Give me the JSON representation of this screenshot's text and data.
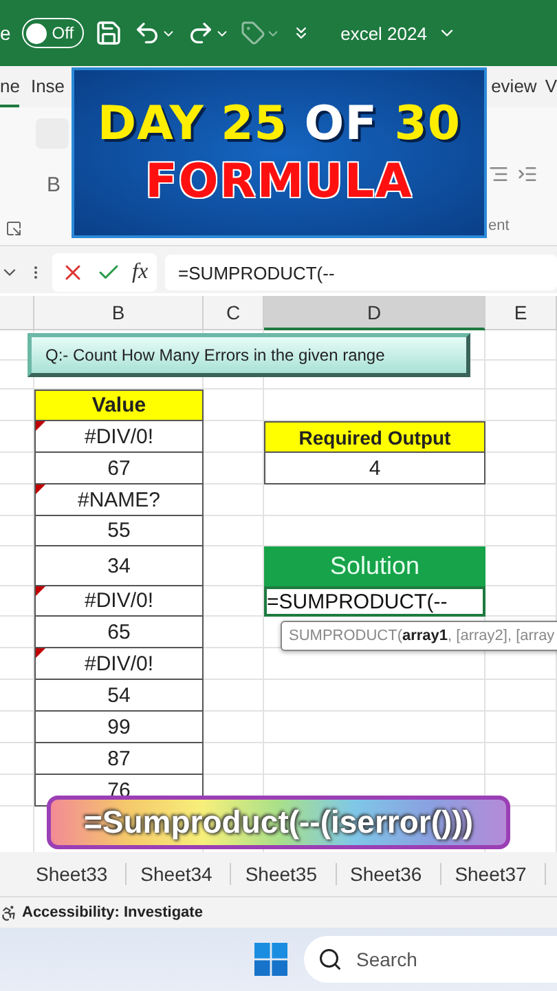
{
  "title_bar": {
    "autosave_label": "e",
    "toggle": {
      "label": "Off",
      "on": false
    },
    "file_name": "excel 2024"
  },
  "ribbon_tabs": [
    {
      "label": "ne",
      "selected": true
    },
    {
      "label": "Inse",
      "selected": false
    },
    {
      "label": "eview",
      "selected": false
    },
    {
      "label": "V",
      "selected": false
    }
  ],
  "ribbon": {
    "bold_label": "B",
    "group_label": "ent"
  },
  "banner": {
    "line_1": [
      {
        "text": "DAY 25",
        "emphasis": false
      },
      {
        "text": "OF",
        "emphasis": true
      },
      {
        "text": "30",
        "emphasis": false
      }
    ],
    "line_2": "FORMULA"
  },
  "formula_bar": {
    "function_label": "fx",
    "formula": "=SUMPRODUCT(--"
  },
  "columns": [
    {
      "label": "B",
      "selected": false
    },
    {
      "label": "C",
      "selected": false
    },
    {
      "label": "D",
      "selected": true
    },
    {
      "label": "E",
      "selected": false
    }
  ],
  "question": "Q:- Count How Many Errors in the given range",
  "value_header": "Value",
  "values": [
    {
      "text": "#DIV/0!",
      "flagged": true
    },
    {
      "text": "67",
      "flagged": false
    },
    {
      "text": "#NAME?",
      "flagged": true
    },
    {
      "text": "55",
      "flagged": false
    },
    {
      "text": "34",
      "flagged": false
    },
    {
      "text": "#DIV/0!",
      "flagged": true
    },
    {
      "text": "65",
      "flagged": false
    },
    {
      "text": "#DIV/0!",
      "flagged": true
    },
    {
      "text": "54",
      "flagged": false
    },
    {
      "text": "99",
      "flagged": false
    },
    {
      "text": "87",
      "flagged": false
    },
    {
      "text": "76",
      "flagged": false
    }
  ],
  "output": {
    "header": "Required Output",
    "value": "4"
  },
  "solution": {
    "header": "Solution",
    "input": "=SUMPRODUCT(--",
    "tooltip": "SUMPRODUCT(**array1**, [array2], [array"
  },
  "caption": "=Sumproduct(--(iserror()))",
  "sheet_tabs": [
    {
      "label": "Sheet33",
      "selected": false
    },
    {
      "label": "Sheet34",
      "selected": false
    },
    {
      "label": "Sheet35",
      "selected": false
    },
    {
      "label": "Sheet36",
      "selected": false
    },
    {
      "label": "Sheet37",
      "selected": false
    }
  ],
  "status_bar": {
    "accessibility": "Accessibility: Investigate"
  },
  "taskbar": {
    "search_placeholder": "Search"
  }
}
